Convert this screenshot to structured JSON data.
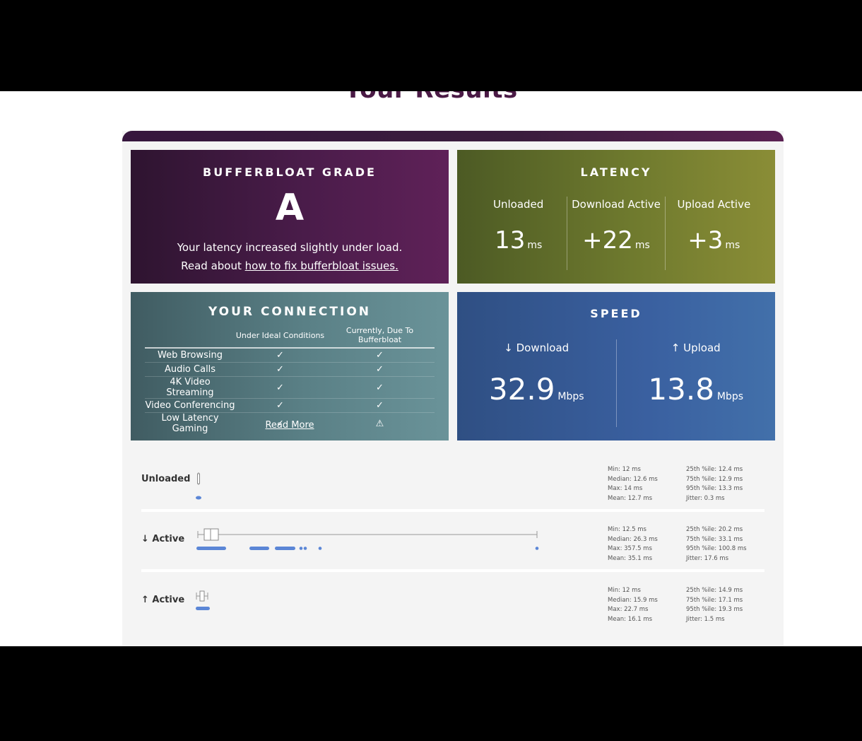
{
  "page_title": "Your Results",
  "grade": {
    "heading": "BUFFERBLOAT GRADE",
    "letter": "A",
    "line1": "Your latency increased slightly under load.",
    "line2_prefix": "Read about ",
    "link": "how to fix bufferbloat issues."
  },
  "latency": {
    "heading": "LATENCY",
    "columns": [
      {
        "label": "Unloaded",
        "value": "13",
        "unit": "ms"
      },
      {
        "label": "Download Active",
        "value": "+22",
        "unit": "ms"
      },
      {
        "label": "Upload Active",
        "value": "+3",
        "unit": "ms"
      }
    ]
  },
  "connection": {
    "heading": "YOUR CONNECTION",
    "col_ideal": "Under Ideal Conditions",
    "col_current": "Currently, Due To Bufferbloat",
    "rows": [
      {
        "name": "Web Browsing",
        "ideal": "✓",
        "current": "✓"
      },
      {
        "name": "Audio Calls",
        "ideal": "✓",
        "current": "✓"
      },
      {
        "name": "4K Video Streaming",
        "ideal": "✓",
        "current": "✓"
      },
      {
        "name": "Video Conferencing",
        "ideal": "✓",
        "current": "✓"
      },
      {
        "name": "Low Latency Gaming",
        "ideal": "✓",
        "current": "⚠"
      }
    ],
    "read_more": "Read More"
  },
  "speed": {
    "heading": "SPEED",
    "download": {
      "label": "↓ Download",
      "value": "32.9",
      "unit": "Mbps"
    },
    "upload": {
      "label": "↑ Upload",
      "value": "13.8",
      "unit": "Mbps"
    }
  },
  "latency_details": [
    {
      "label": "Unloaded",
      "stats_left": [
        "Min: 12 ms",
        "Median: 12.6 ms",
        "Max: 14 ms",
        "Mean: 12.7 ms"
      ],
      "stats_right": [
        "25th %ile: 12.4 ms",
        "75th %ile: 12.9 ms",
        "95th %ile: 13.3 ms",
        "Jitter: 0.3 ms"
      ]
    },
    {
      "label": "↓ Active",
      "stats_left": [
        "Min: 12.5 ms",
        "Median: 26.3 ms",
        "Max: 357.5 ms",
        "Mean: 35.1 ms"
      ],
      "stats_right": [
        "25th %ile: 20.2 ms",
        "75th %ile: 33.1 ms",
        "95th %ile: 100.8 ms",
        "Jitter: 17.6 ms"
      ]
    },
    {
      "label": "↑ Active",
      "stats_left": [
        "Min: 12 ms",
        "Median: 15.9 ms",
        "Max: 22.7 ms",
        "Mean: 16.1 ms"
      ],
      "stats_right": [
        "25th %ile: 14.9 ms",
        "75th %ile: 17.1 ms",
        "95th %ile: 19.3 ms",
        "Jitter: 1.5 ms"
      ]
    }
  ],
  "colors": {
    "grade_bg": "#4a1c4a",
    "latency_bg": "#6f7a2e",
    "connection_bg": "#5a8086",
    "speed_bg": "#3a60a0",
    "dot_color": "#5b86d6"
  }
}
